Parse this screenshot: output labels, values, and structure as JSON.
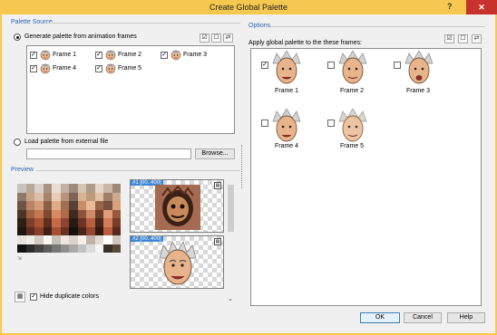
{
  "window": {
    "title": "Create Global Palette",
    "help_glyph": "?",
    "close_glyph": "✕"
  },
  "palette_source": {
    "label": "Palette Source",
    "generate_label": "Generate palette from animation frames",
    "frames": [
      {
        "label": "Frame 1",
        "checked": true
      },
      {
        "label": "Frame 2",
        "checked": true
      },
      {
        "label": "Frame 3",
        "checked": true
      },
      {
        "label": "Frame 4",
        "checked": true
      },
      {
        "label": "Frame 5",
        "checked": true
      }
    ],
    "load_label": "Load palette from external file",
    "file_path": "",
    "browse_label": "Browse..."
  },
  "preview": {
    "label": "Preview",
    "thumbnails": [
      {
        "tag": "#1 [00..400]"
      },
      {
        "tag": "#2 [00..400]"
      }
    ],
    "hide_duplicates_label": "Hide duplicate colors",
    "hide_duplicates_checked": true
  },
  "options": {
    "label": "Options",
    "apply_label": "Apply global palette to the these frames:",
    "frames": [
      {
        "label": "Frame 1",
        "checked": true
      },
      {
        "label": "Frame 2",
        "checked": false
      },
      {
        "label": "Frame 3",
        "checked": false
      },
      {
        "label": "Frame 4",
        "checked": false
      },
      {
        "label": "Frame 5",
        "checked": false
      }
    ]
  },
  "buttons": {
    "ok": "OK",
    "cancel": "Cancel",
    "help": "Help"
  },
  "check_glyph": "✓",
  "colors": {
    "titlebar": "#f6c84f",
    "close": "#c7322c",
    "section": "#2c63b5",
    "tag": "#3b86d6",
    "palette": [
      "#c9c1bb",
      "#b8a89a",
      "#d9d0c8",
      "#a99484",
      "#e8ddd3",
      "#c2b2a5",
      "#9c8a7d",
      "#d6c4b2",
      "#b09a88",
      "#e4d6c8",
      "#cbb7a5",
      "#a08b7a",
      "#8e7a6d",
      "#c7a389",
      "#dcbfa8",
      "#a6846b",
      "#e8cdb6",
      "#b99379",
      "#7d6657",
      "#d8b294",
      "#c0997c",
      "#e1c2a7",
      "#9f7f68",
      "#cfa98b",
      "#6e5445",
      "#b88264",
      "#d59b76",
      "#8a5f47",
      "#e0ac86",
      "#a36f52",
      "#5b4133",
      "#c98d67",
      "#e7bb98",
      "#9a6448",
      "#7a5140",
      "#d9a07c",
      "#4d3427",
      "#a0613f",
      "#c27652",
      "#7e4a33",
      "#d88a63",
      "#b06a48",
      "#3f2a20",
      "#8c5339",
      "#cf8a66",
      "#6e3f2c",
      "#e19c78",
      "#99583b",
      "#2f1f18",
      "#7d3f2a",
      "#a95438",
      "#5e2f21",
      "#c66a49",
      "#8d4530",
      "#281a14",
      "#6b3424",
      "#b65f41",
      "#4a261b",
      "#d37a59",
      "#7a3b29",
      "#1f1511",
      "#5c2c1e",
      "#8a3f2b",
      "#3e2017",
      "#a84e35",
      "#6a3121",
      "#17100d",
      "#4b2419",
      "#93452f",
      "#331a13",
      "#be5c41",
      "#572a1d",
      "#e7e2de",
      "#f1ece8",
      "#d3ccc6",
      "#fbf7f3",
      "#c8bfb8",
      "#efe6df",
      "#dcd3cc",
      "#f6efe9",
      "#bdb3ab",
      "#e3d9d1",
      "#ffffff",
      "#cfc5bd",
      "#121212",
      "#2b2b2b",
      "#444444",
      "#5d5d5d",
      "#777777",
      "#909090",
      "#a9a9a9",
      "#c2c2c2",
      "#dbdbdb",
      "#f4f4f4",
      "#3a3028",
      "#5a4a3c"
    ]
  }
}
